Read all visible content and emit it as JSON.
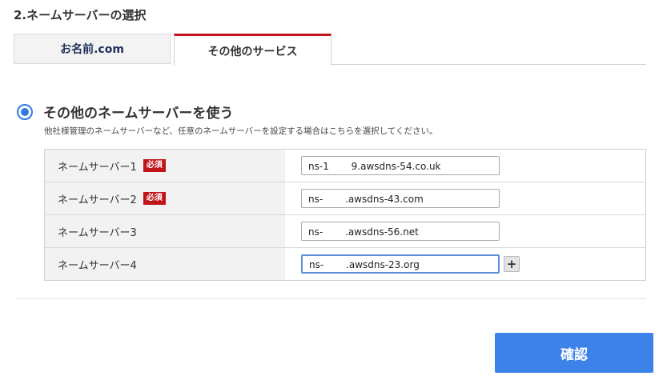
{
  "section_title": "2.ネームサーバーの選択",
  "tabs": [
    {
      "label": "お名前.com",
      "active": false
    },
    {
      "label": "その他のサービス",
      "active": true
    }
  ],
  "option": {
    "label": "その他のネームサーバーを使う",
    "selected": true,
    "description": "他社様管理のネームサーバーなど、任意のネームサーバーを設定する場合はこちらを選択してください。"
  },
  "nameservers": [
    {
      "label": "ネームサーバー1",
      "required_badge": "必須",
      "value": "ns-1　　 9.awsdns-54.co.uk"
    },
    {
      "label": "ネームサーバー2",
      "required_badge": "必須",
      "value": "ns-　　 .awsdns-43.com"
    },
    {
      "label": "ネームサーバー3",
      "required_badge": "",
      "value": "ns-　　 .awsdns-56.net"
    },
    {
      "label": "ネームサーバー4",
      "required_badge": "",
      "value": "ns-　　 .awsdns-23.org"
    }
  ],
  "add_button_symbol": "+",
  "confirm_label": "確認",
  "colors": {
    "accent_blue": "#3c82e9",
    "required_red": "#c0131a",
    "tab_active_border": "#c4161c"
  }
}
